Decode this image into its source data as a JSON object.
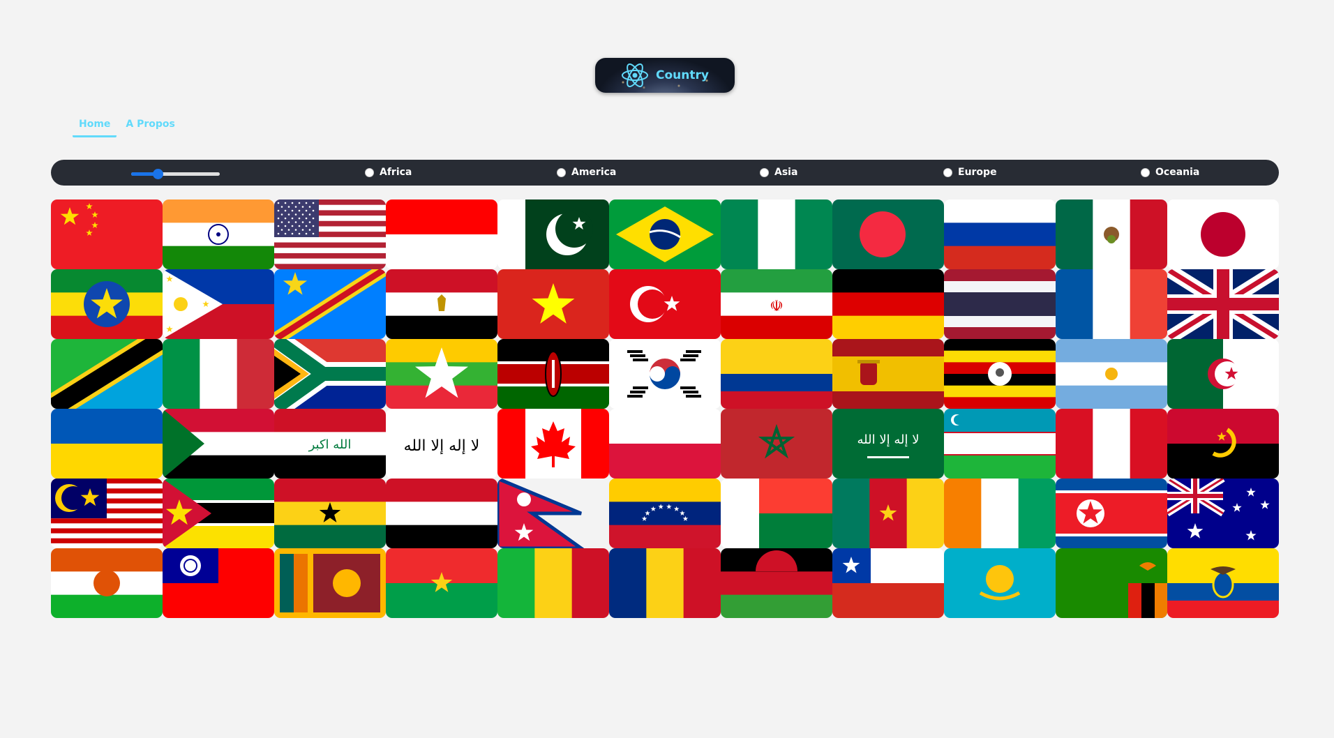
{
  "app": {
    "title": "Country"
  },
  "nav": {
    "home": "Home",
    "about": "A Propos"
  },
  "filter": {
    "slider_fraction": 0.3,
    "regions": [
      "Africa",
      "America",
      "Asia",
      "Europe",
      "Oceania"
    ]
  },
  "flag_icons": [
    "china-flag-icon",
    "india-flag-icon",
    "usa-flag-icon",
    "indonesia-flag-icon",
    "pakistan-flag-icon",
    "brazil-flag-icon",
    "nigeria-flag-icon",
    "bangladesh-flag-icon",
    "russia-flag-icon",
    "mexico-flag-icon",
    "japan-flag-icon",
    "ethiopia-flag-icon",
    "philippines-flag-icon",
    "dr-congo-flag-icon",
    "egypt-flag-icon",
    "vietnam-flag-icon",
    "turkey-flag-icon",
    "iran-flag-icon",
    "germany-flag-icon",
    "thailand-flag-icon",
    "france-flag-icon",
    "uk-flag-icon",
    "tanzania-flag-icon",
    "italy-flag-icon",
    "south-africa-flag-icon",
    "myanmar-flag-icon",
    "kenya-flag-icon",
    "south-korea-flag-icon",
    "colombia-flag-icon",
    "spain-flag-icon",
    "uganda-flag-icon",
    "argentina-flag-icon",
    "algeria-flag-icon",
    "ukraine-flag-icon",
    "sudan-flag-icon",
    "iraq-flag-icon",
    "afghanistan-flag-icon",
    "canada-flag-icon",
    "poland-flag-icon",
    "morocco-flag-icon",
    "saudi-arabia-flag-icon",
    "uzbekistan-flag-icon",
    "peru-flag-icon",
    "angola-flag-icon",
    "malaysia-flag-icon",
    "mozambique-flag-icon",
    "ghana-flag-icon",
    "yemen-flag-icon",
    "nepal-flag-icon",
    "venezuela-flag-icon",
    "madagascar-flag-icon",
    "cameroon-flag-icon",
    "ivory-coast-flag-icon",
    "north-korea-flag-icon",
    "australia-flag-icon",
    "niger-flag-icon",
    "taiwan-flag-icon",
    "sri-lanka-flag-icon",
    "burkina-faso-flag-icon",
    "mali-flag-icon",
    "romania-flag-icon",
    "malawi-flag-icon",
    "chile-flag-icon",
    "kazakhstan-flag-icon",
    "zambia-flag-icon",
    "ecuador-flag-icon"
  ]
}
